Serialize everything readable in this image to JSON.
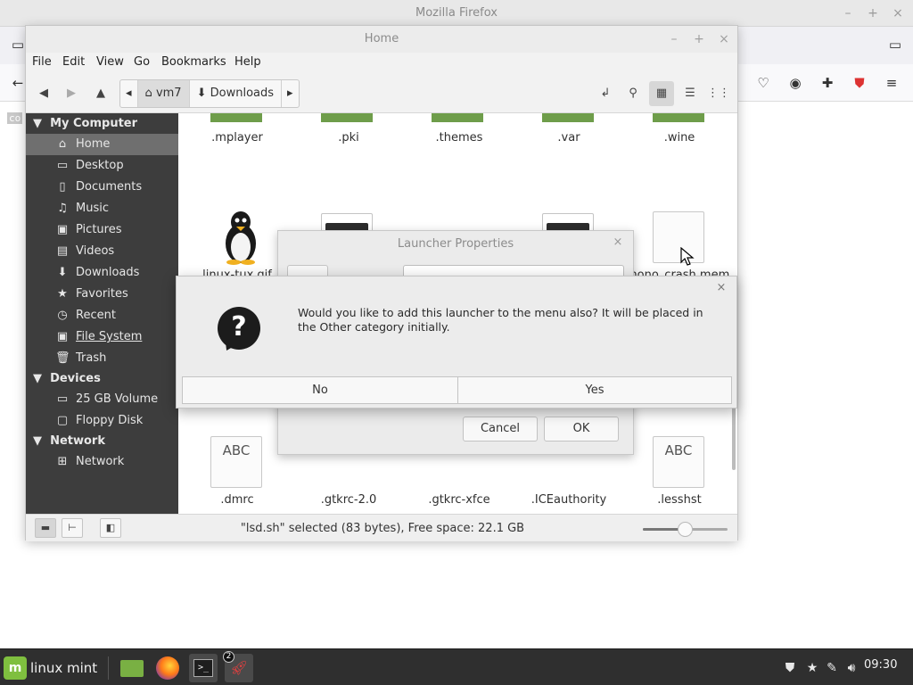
{
  "firefox": {
    "title": "Mozilla Firefox",
    "page_code_text": "co"
  },
  "nemo": {
    "title": "Home",
    "menu": [
      "File",
      "Edit",
      "View",
      "Go",
      "Bookmarks",
      "Help"
    ],
    "breadcrumbs": [
      "vm7",
      "Downloads"
    ],
    "sidebar": {
      "sections": [
        {
          "title": "My Computer",
          "items": [
            {
              "label": "Home",
              "icon": "home-icon",
              "selected": true
            },
            {
              "label": "Desktop",
              "icon": "desktop-icon"
            },
            {
              "label": "Documents",
              "icon": "documents-icon"
            },
            {
              "label": "Music",
              "icon": "music-icon"
            },
            {
              "label": "Pictures",
              "icon": "pictures-icon"
            },
            {
              "label": "Videos",
              "icon": "videos-icon"
            },
            {
              "label": "Downloads",
              "icon": "downloads-icon"
            },
            {
              "label": "Favorites",
              "icon": "star-icon"
            },
            {
              "label": "Recent",
              "icon": "clock-icon"
            },
            {
              "label": "File System",
              "icon": "drive-icon"
            },
            {
              "label": "Trash",
              "icon": "trash-icon"
            }
          ]
        },
        {
          "title": "Devices",
          "items": [
            {
              "label": "25 GB Volume",
              "icon": "drive-icon"
            },
            {
              "label": "Floppy Disk",
              "icon": "floppy-icon"
            }
          ]
        },
        {
          "title": "Network",
          "items": [
            {
              "label": "Network",
              "icon": "network-icon"
            }
          ]
        }
      ]
    },
    "files": {
      "row1": [
        ".mplayer",
        ".pki",
        ".themes",
        ".var",
        ".wine"
      ],
      "row2": [
        "linux-tux.gif",
        "",
        "",
        "",
        "mono_crash.mem.\n9732.1.blob"
      ],
      "row3": [
        ".dmrc",
        ".gtkrc-2.0",
        ".gtkrc-xfce",
        ".ICEauthority",
        ".lesshst"
      ],
      "doc_icon_text": "ABC",
      "terminal_prompt": ">_"
    },
    "status": "\"lsd.sh\" selected (83 bytes), Free space: 22.1 GB",
    "zoom_level": 0.5
  },
  "launcher": {
    "title": "Launcher Properties",
    "cancel_label": "Cancel",
    "ok_label": "OK"
  },
  "dialog": {
    "message": "Would you like to add this launcher to the menu also?  It will be placed in the Other category initially.",
    "no_label": "No",
    "yes_label": "Yes"
  },
  "taskbar": {
    "menu_label": "linux mint",
    "apps": [
      "files-icon",
      "firefox-icon",
      "terminal-icon",
      "rocket-icon"
    ],
    "badge_count": "2",
    "clock": "09:30"
  },
  "colors": {
    "sidebar_bg": "#3d3d3d",
    "folder_green": "#6e9d4a",
    "mint_green": "#7fbf3f",
    "taskbar_bg": "#2f2f2f"
  }
}
